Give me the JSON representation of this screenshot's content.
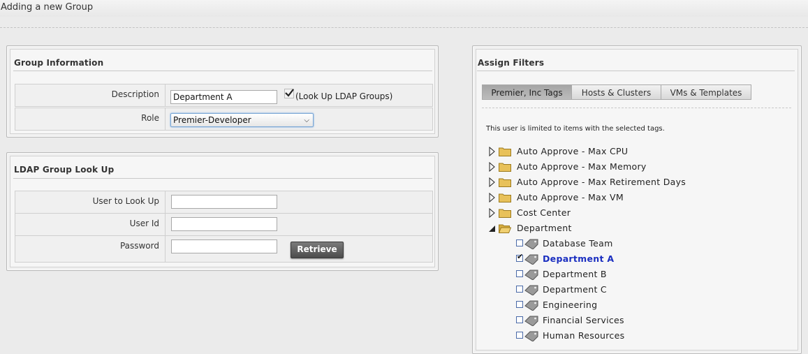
{
  "page": {
    "title": "Adding a new Group"
  },
  "group_info": {
    "title": "Group Information",
    "description_label": "Description",
    "description_value": "Department A",
    "lookup_ldap_label": "(Look Up LDAP Groups)",
    "lookup_ldap_checked": true,
    "role_label": "Role",
    "role_value": "Premier-Developer"
  },
  "ldap_lookup": {
    "title": "LDAP Group Look Up",
    "user_label": "User to Look Up",
    "user_value": "",
    "userid_label": "User Id",
    "userid_value": "",
    "password_label": "Password",
    "password_value": "",
    "retrieve_label": "Retrieve"
  },
  "filters": {
    "title": "Assign Filters",
    "tabs": [
      {
        "label": "Premier, Inc Tags",
        "active": true
      },
      {
        "label": "Hosts & Clusters",
        "active": false
      },
      {
        "label": "VMs & Templates",
        "active": false
      }
    ],
    "notice": "This user is limited to items with the selected tags.",
    "tree": [
      {
        "label": "Auto Approve - Max CPU",
        "expanded": false
      },
      {
        "label": "Auto Approve - Max Memory",
        "expanded": false
      },
      {
        "label": "Auto Approve - Max Retirement Days",
        "expanded": false
      },
      {
        "label": "Auto Approve - Max VM",
        "expanded": false
      },
      {
        "label": "Cost Center",
        "expanded": false
      },
      {
        "label": "Department",
        "expanded": true
      }
    ],
    "department_tags": [
      {
        "label": "Database Team",
        "checked": false
      },
      {
        "label": "Department A",
        "checked": true
      },
      {
        "label": "Department B",
        "checked": false
      },
      {
        "label": "Department C",
        "checked": false
      },
      {
        "label": "Engineering",
        "checked": false
      },
      {
        "label": "Financial Services",
        "checked": false
      },
      {
        "label": "Human Resources",
        "checked": false
      }
    ]
  },
  "colors": {
    "selected_tag": "#1a2ec0",
    "button_dark": "#555555"
  }
}
